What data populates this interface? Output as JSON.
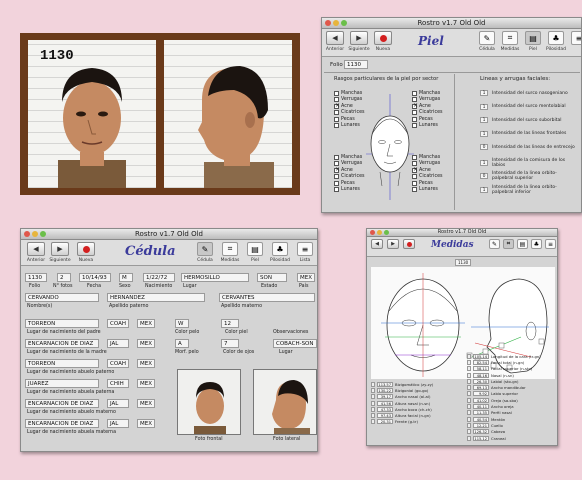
{
  "mugshots": {
    "number": "1130",
    "labels": [
      "Foto frontal",
      "Foto lateral"
    ]
  },
  "piel_window": {
    "title": "Rostro v1.7 Old Old",
    "toolbar": {
      "nav": [
        {
          "label": "Anterior",
          "glyph": "◀"
        },
        {
          "label": "Siguiente",
          "glyph": "▶"
        },
        {
          "label": "Nueva",
          "glyph": "●"
        }
      ],
      "app_title": "Piel",
      "tools": [
        {
          "label": "Cédula",
          "icon": "pen-icon"
        },
        {
          "label": "Medidas",
          "icon": "ruler-icon"
        },
        {
          "label": "Piel",
          "icon": "notepad-icon"
        },
        {
          "label": "Pilosidad",
          "icon": "brush-icon"
        },
        {
          "label": "Lista",
          "icon": "list-icon"
        }
      ]
    },
    "folio_label": "Folio",
    "folio_value": "1130",
    "rasgos_title": "Rasgos particulares de la piel por sector",
    "lineas_title": "Lineas y arrugas faciales:",
    "skin_items": [
      "Manchas",
      "Verrugas",
      "Acne",
      "Cicatrices",
      "Pecas",
      "Lunares"
    ],
    "checked": {
      "top_left": [
        "Acne"
      ],
      "top_right": [
        "Acne"
      ],
      "bottom_left": [
        "Acne"
      ],
      "bottom_right": [
        "Acne"
      ]
    },
    "lineas": [
      {
        "value": "1",
        "label": "Intensidad del surco nasogeniano"
      },
      {
        "value": "1",
        "label": "Intensidad del surco mentolabial"
      },
      {
        "value": "1",
        "label": "Intensidad del surco suborbital"
      },
      {
        "value": "1",
        "label": "Intensidad de las lineas frontales"
      },
      {
        "value": "0",
        "label": "Intensidad de las lineas de entrecejo"
      },
      {
        "value": "1",
        "label": "Intensidad de la comisura de los labios"
      },
      {
        "value": "0",
        "label": "Intensidad de la linea orbito-palpebral superior"
      },
      {
        "value": "1",
        "label": "Intensidad de la linea orbito-palpebral inferior"
      }
    ]
  },
  "cedula_window": {
    "title": "Rostro v1.7 Old Old",
    "toolbar": {
      "nav": [
        {
          "label": "Anterior",
          "glyph": "◀"
        },
        {
          "label": "Siguiente",
          "glyph": "▶"
        },
        {
          "label": "Nueva",
          "glyph": "●"
        }
      ],
      "app_title": "Cédula",
      "tools": [
        {
          "label": "Cédula",
          "icon": "pen-icon"
        },
        {
          "label": "Medidas",
          "icon": "ruler-icon"
        },
        {
          "label": "Piel",
          "icon": "notepad-icon"
        },
        {
          "label": "Pilosidad",
          "icon": "brush-icon"
        },
        {
          "label": "Lista",
          "icon": "list-icon"
        }
      ]
    },
    "row1": {
      "folio": "1130",
      "n_fotos": "2",
      "fecha": "10/14/93",
      "sexo": "M",
      "nacimiento": "1/22/72",
      "lugar": "HERMOSILLO",
      "estado": "SON",
      "pais": "MEX"
    },
    "row1_labels": {
      "folio": "Folio",
      "n_fotos": "N° fotos",
      "fecha": "Fecha",
      "sexo": "Sexo",
      "nacimiento": "Nacimiento",
      "lugar": "Lugar",
      "estado": "Estado",
      "pais": "País"
    },
    "names": {
      "nombre": "CERVANDO",
      "paterno": "HERNANDEZ",
      "materno": "CERVANTES"
    },
    "names_labels": {
      "nombre": "Nombre(s)",
      "paterno": "Apellido paterno",
      "materno": "Apellido materno"
    },
    "origins": [
      {
        "place": "TORREON",
        "state": "COAH",
        "country": "MEX",
        "label": "Lugar de nacimiento del padre"
      },
      {
        "place": "ENCARNACION DE DIAZ",
        "state": "JAL",
        "country": "MEX",
        "label": "Lugar de nacimiento de la madre"
      },
      {
        "place": "TORREON",
        "state": "COAH",
        "country": "MEX",
        "label": "Lugar de nacimiento abuelo paterno"
      },
      {
        "place": "JUAREZ",
        "state": "CHIH",
        "country": "MEX",
        "label": "Lugar de nacimiento abuela paterna"
      },
      {
        "place": "ENCARNACION DE DIAZ",
        "state": "JAL",
        "country": "MEX",
        "label": "Lugar de nacimiento abuelo materno"
      },
      {
        "place": "ENCARNACION DE DIAZ",
        "state": "JAL",
        "country": "MEX",
        "label": "Lugar de nacimiento abuela materna"
      }
    ],
    "color_pelo": {
      "value": "W",
      "label": "Color pelo"
    },
    "color_piel": {
      "value": "12",
      "label": "Color piel"
    },
    "morf_pelo": {
      "value": "A",
      "label": "Morf. pelo"
    },
    "color_ojos": {
      "value": "7",
      "label": "Color de ojos"
    },
    "observaciones_label": "Observaciones",
    "observaciones_value": "COBACH-SON",
    "lugar_label": "Lugar",
    "photo_labels": {
      "front": "Foto frontal",
      "side": "Foto lateral"
    }
  },
  "medidas_window": {
    "title": "Rostro v1.7 Old Old",
    "app_title": "Medidas",
    "folio": "1130",
    "left_meas": [
      {
        "v": "113.57",
        "l": "Bizigomático (zy-zy)"
      },
      {
        "v": "130.22",
        "l": "Bizigonial (go-go)"
      },
      {
        "v": "39.17",
        "l": "Ancho nasal (al-al)"
      },
      {
        "v": "41.56",
        "l": "Altura nasal (n-sn)"
      },
      {
        "v": "47.33",
        "l": "Ancho boca (ch-ch)"
      },
      {
        "v": "97.43",
        "l": "Altura facial (n-gn)"
      },
      {
        "v": "20.31",
        "l": "Frente (g-tr)"
      }
    ],
    "right_meas": [
      {
        "v": "105.14",
        "l": "Longitud de la cara (tr-gn)"
      },
      {
        "v": "82.54",
        "l": "Facial total (n-gn)"
      },
      {
        "v": "58.11",
        "l": "Facial superior (n-sto)"
      },
      {
        "v": "48.16",
        "l": "Nasal (n-sn)"
      },
      {
        "v": "26.30",
        "l": "Labial (sto-gn)"
      },
      {
        "v": "69.13",
        "l": "Ancho mandibular"
      },
      {
        "v": "9.92",
        "l": "Labio superior"
      },
      {
        "v": "41.02",
        "l": "Oreja (sa-sba)"
      },
      {
        "v": "40.11",
        "l": "Ancho oreja"
      },
      {
        "v": "11.35",
        "l": "Perfil nasal"
      },
      {
        "v": "40.54",
        "l": "Mentón"
      },
      {
        "v": "12.21",
        "l": "Cuello"
      },
      {
        "v": "126.32",
        "l": "Cabeza"
      },
      {
        "v": "115.12",
        "l": "Craneal"
      }
    ]
  }
}
